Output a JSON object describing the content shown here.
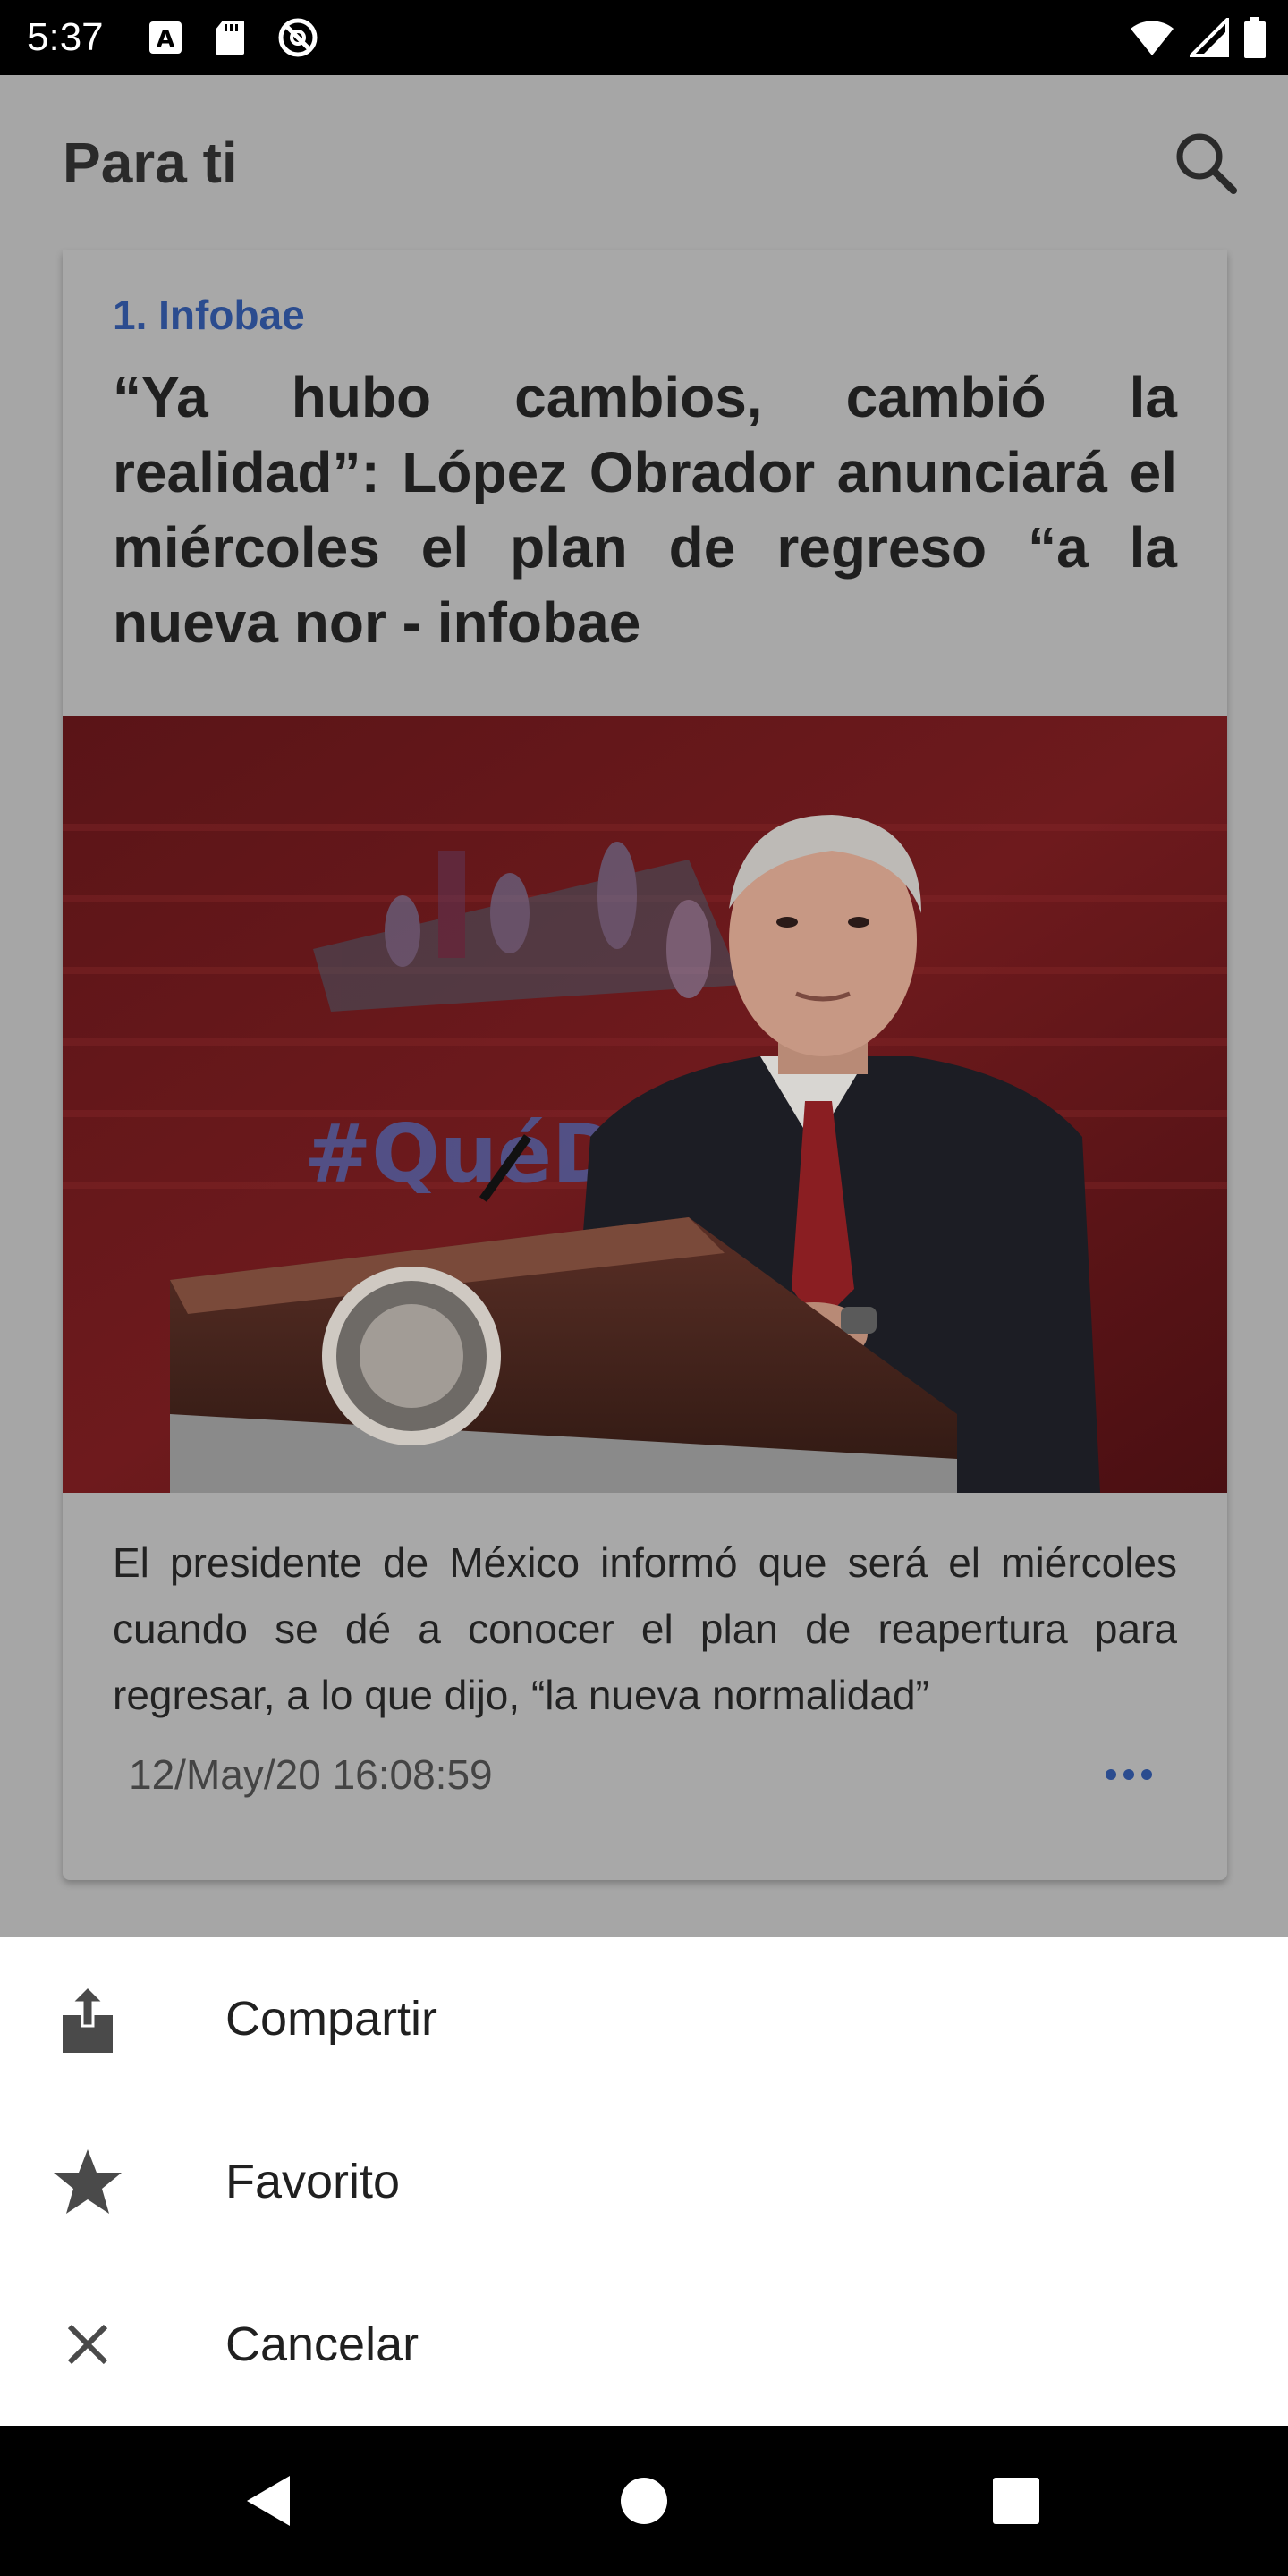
{
  "status_bar": {
    "time": "5:37",
    "left_icons": [
      "a-notification-icon",
      "sd-card-icon",
      "do-not-disturb-icon"
    ],
    "right_icons": [
      "wifi-icon",
      "signal-icon",
      "battery-icon"
    ]
  },
  "app_bar": {
    "title": "Para ti",
    "search_icon": "search-icon"
  },
  "article": {
    "source": "1. Infobae",
    "headline": "“Ya hubo cambios, cambió la realidad”: López Obrador anunciará el miércoles el plan de regreso “a la nueva nor - infobae",
    "image_text": "#QuéDa",
    "summary": "El presidente de México informó que será el miércoles cuando se dé a conocer el plan de reapertura para regresar, a lo que dijo, “la nueva normalidad”",
    "date": "12/May/20 16:08:59",
    "more_icon": "more-horizontal-icon"
  },
  "bottom_sheet": {
    "items": [
      {
        "label": "Compartir",
        "icon": "share-icon"
      },
      {
        "label": "Favorito",
        "icon": "star-icon"
      },
      {
        "label": "Cancelar",
        "icon": "close-icon"
      }
    ]
  },
  "nav_bar": {
    "icons": [
      "back-icon",
      "home-icon",
      "recents-icon"
    ]
  },
  "colors": {
    "accent": "#2b4c8f",
    "scrim_background": "#a6a6a6",
    "sheet_background": "#ffffff",
    "system_bars": "#000000"
  }
}
